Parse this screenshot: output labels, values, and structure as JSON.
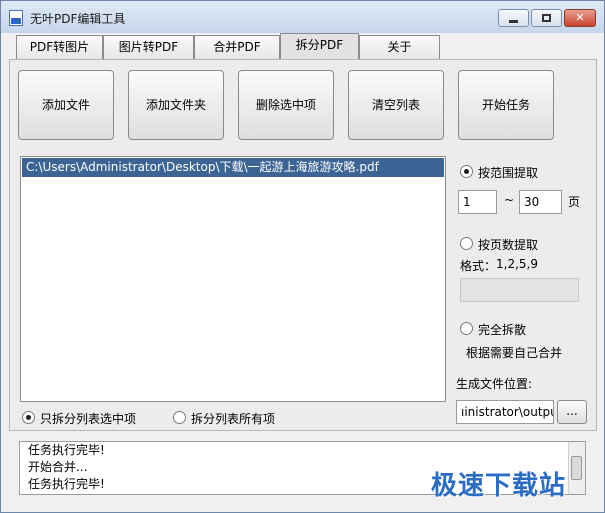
{
  "window": {
    "title": "无叶PDF编辑工具"
  },
  "tabs": [
    {
      "label": "PDF转图片"
    },
    {
      "label": "图片转PDF"
    },
    {
      "label": "合并PDF"
    },
    {
      "label": "拆分PDF"
    },
    {
      "label": "关于"
    }
  ],
  "toolbar": {
    "add_file": "添加文件",
    "add_folder": "添加文件夹",
    "delete_selected": "删除选中项",
    "clear_list": "清空列表",
    "start_task": "开始任务"
  },
  "file_list": {
    "items": [
      "C:\\Users\\Administrator\\Desktop\\下载\\一起游上海旅游攻略.pdf"
    ]
  },
  "split_scope": {
    "selected_only": "只拆分列表选中项",
    "all": "拆分列表所有项",
    "checked": "selected_only"
  },
  "options": {
    "by_range": "按范围提取",
    "range_from": "1",
    "range_sep": "~",
    "range_to": "30",
    "page_unit": "页",
    "by_pages": "按页数提取",
    "format_label": "格式：",
    "format_example": "1,2,5,9",
    "pages_value": "",
    "full_split": "完全拆散",
    "full_split_hint": "根据需要自己合并",
    "checked": "by_range"
  },
  "output": {
    "label": "生成文件位置:",
    "path": "ıinistrator\\output",
    "browse": "..."
  },
  "log": {
    "lines": [
      "任务执行完毕!",
      "开始合并...",
      "任务执行完毕!"
    ]
  },
  "watermark": "极速下载站"
}
